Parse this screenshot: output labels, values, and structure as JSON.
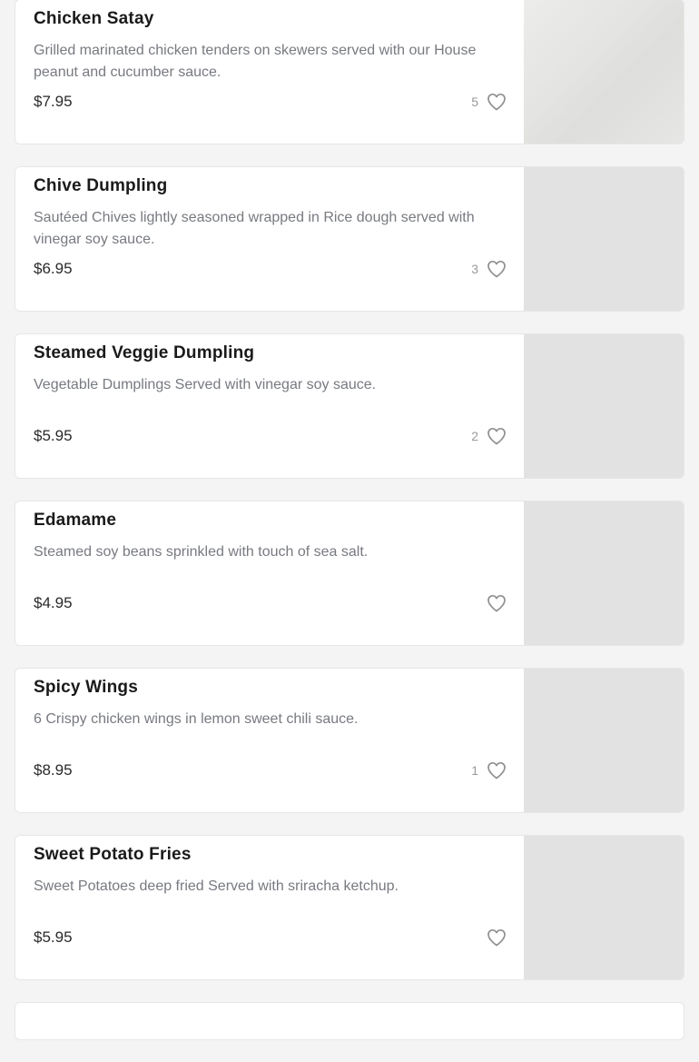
{
  "colors": {
    "page_background": "#f4f4f4",
    "card_background": "#ffffff",
    "title": "#1a1a1a",
    "description": "#777a80",
    "heart_outline": "#8f8f8f",
    "image_placeholder": "#e2e2e2"
  },
  "menu": {
    "items": [
      {
        "name": "Chicken Satay",
        "description": "Grilled marinated chicken tenders on skewers served with our House peanut and cucumber sauce.",
        "price": "$7.95",
        "likes": "5",
        "icon": "heart-outline-icon"
      },
      {
        "name": "Chive Dumpling",
        "description": "Sautéed Chives lightly seasoned wrapped in Rice dough served with vinegar soy sauce.",
        "price": "$6.95",
        "likes": "3",
        "icon": "heart-outline-icon"
      },
      {
        "name": "Steamed Veggie Dumpling",
        "description": "Vegetable Dumplings Served with vinegar soy sauce.",
        "price": "$5.95",
        "likes": "2",
        "icon": "heart-outline-icon"
      },
      {
        "name": "Edamame",
        "description": "Steamed soy beans sprinkled with touch of sea salt.",
        "price": "$4.95",
        "likes": "",
        "icon": "heart-outline-icon"
      },
      {
        "name": "Spicy Wings",
        "description": "6 Crispy chicken wings in lemon sweet chili sauce.",
        "price": "$8.95",
        "likes": "1",
        "icon": "heart-outline-icon"
      },
      {
        "name": "Sweet Potato Fries",
        "description": "Sweet Potatoes deep fried Served with sriracha ketchup.",
        "price": "$5.95",
        "likes": "",
        "icon": "heart-outline-icon"
      }
    ]
  }
}
